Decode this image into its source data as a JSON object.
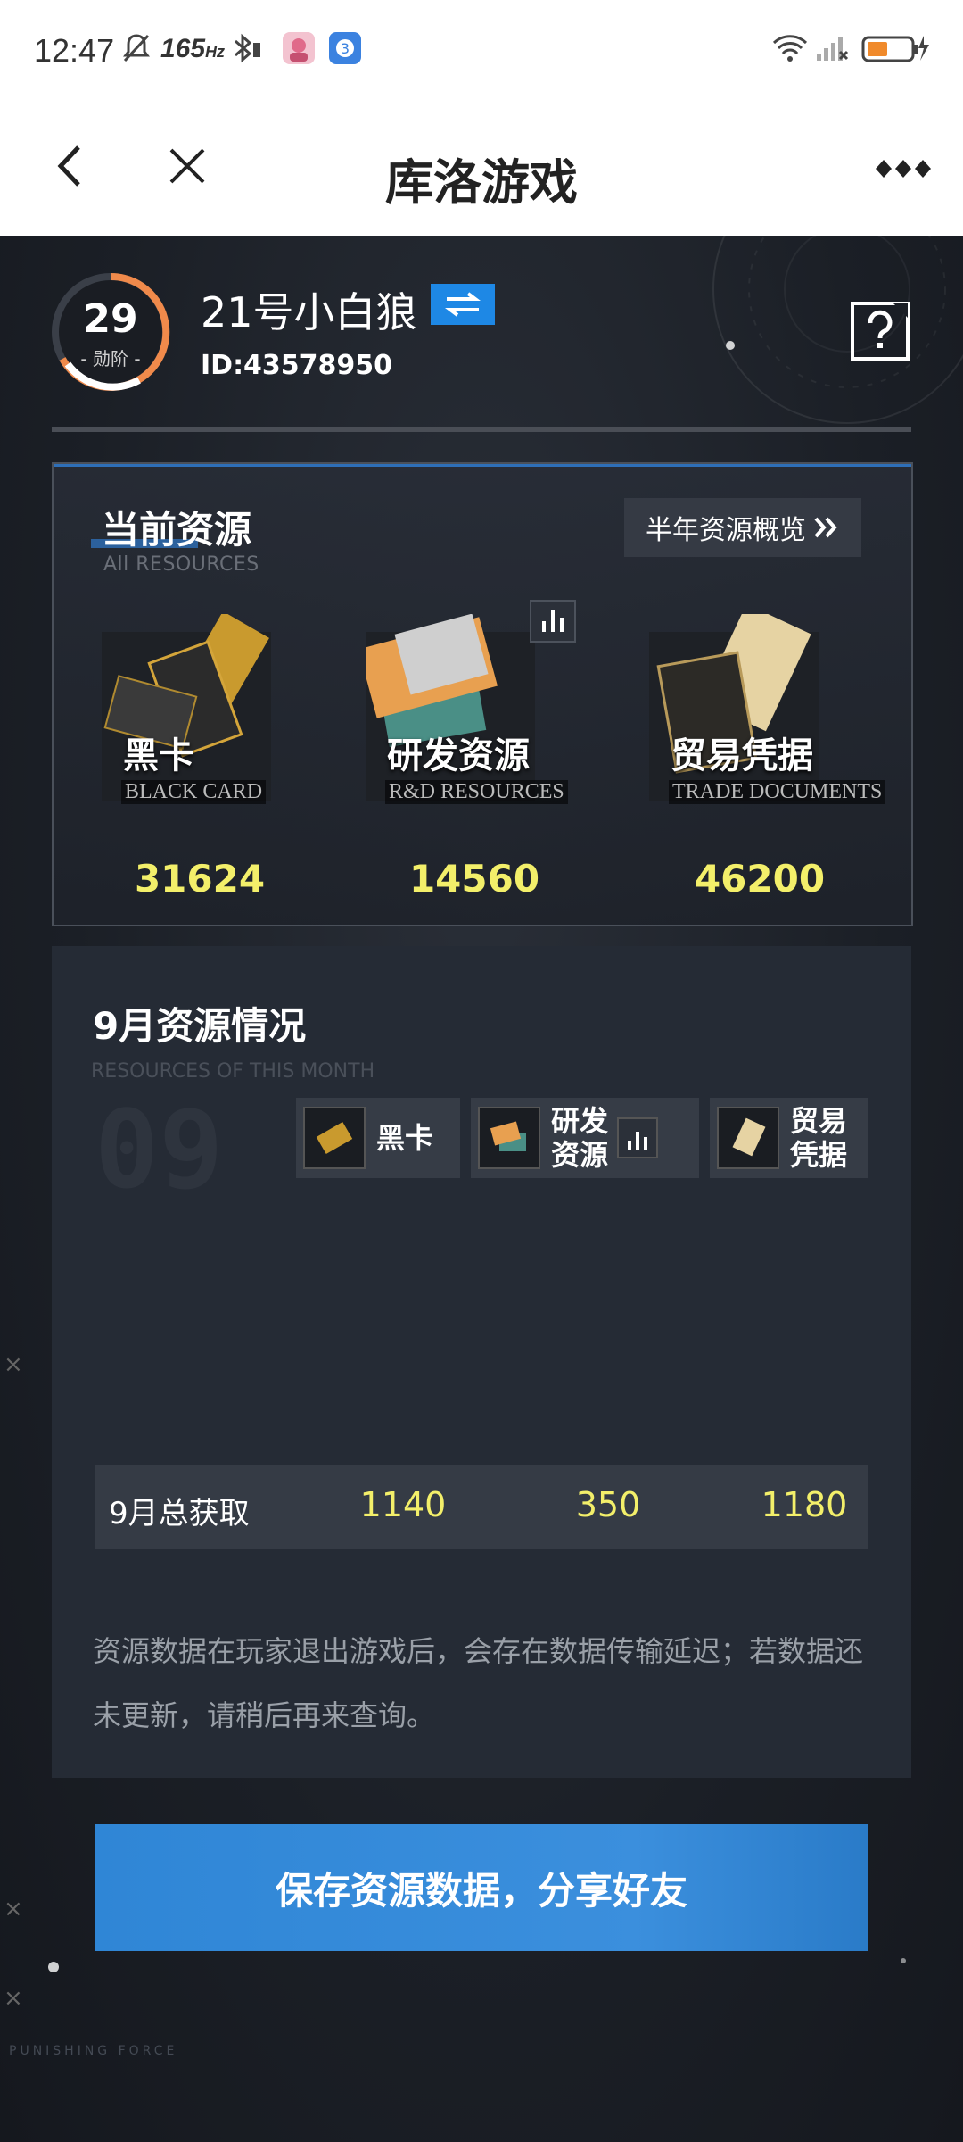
{
  "status_bar": {
    "time": "12:47",
    "refresh_rate": "165",
    "refresh_unit": "Hz",
    "notification_badge": "3"
  },
  "title_bar": {
    "title": "库洛游戏"
  },
  "profile": {
    "rank_number": "29",
    "rank_label": "- 勋阶 -",
    "nickname": "21号小白狼",
    "player_id": "ID:43578950"
  },
  "current_resources": {
    "title": "当前资源",
    "subtitle": "All RESOURCES",
    "overview_button": "半年资源概览",
    "items": [
      {
        "name_cn": "黑卡",
        "name_en": "BLACK CARD",
        "value": "31624"
      },
      {
        "name_cn": "研发资源",
        "name_en": "R&D RESOURCES",
        "value": "14560"
      },
      {
        "name_cn": "贸易凭据",
        "name_en": "TRADE DOCUMENTS",
        "value": "46200"
      }
    ]
  },
  "month_resources": {
    "title": "9月资源情况",
    "subtitle": "RESOURCES OF THIS MONTH",
    "big_number": "09",
    "columns": [
      {
        "label_line1": "黑卡",
        "label_line2": ""
      },
      {
        "label_line1": "研发",
        "label_line2": "资源"
      },
      {
        "label_line1": "贸易",
        "label_line2": "凭据"
      }
    ],
    "total_row": {
      "label": "9月总获取",
      "values": [
        "1140",
        "350",
        "1180"
      ]
    },
    "note": "资源数据在玩家退出游戏后，会存在数据传输延迟；若数据还未更新，请稍后再来查询。",
    "save_button": "保存资源数据，分享好友"
  },
  "footer": {
    "brand": "PUNISHING FORCE"
  },
  "colors": {
    "value_yellow": "#f3ef6a",
    "accent_blue": "#2f86d6",
    "rank_orange": "#f08a4b"
  }
}
